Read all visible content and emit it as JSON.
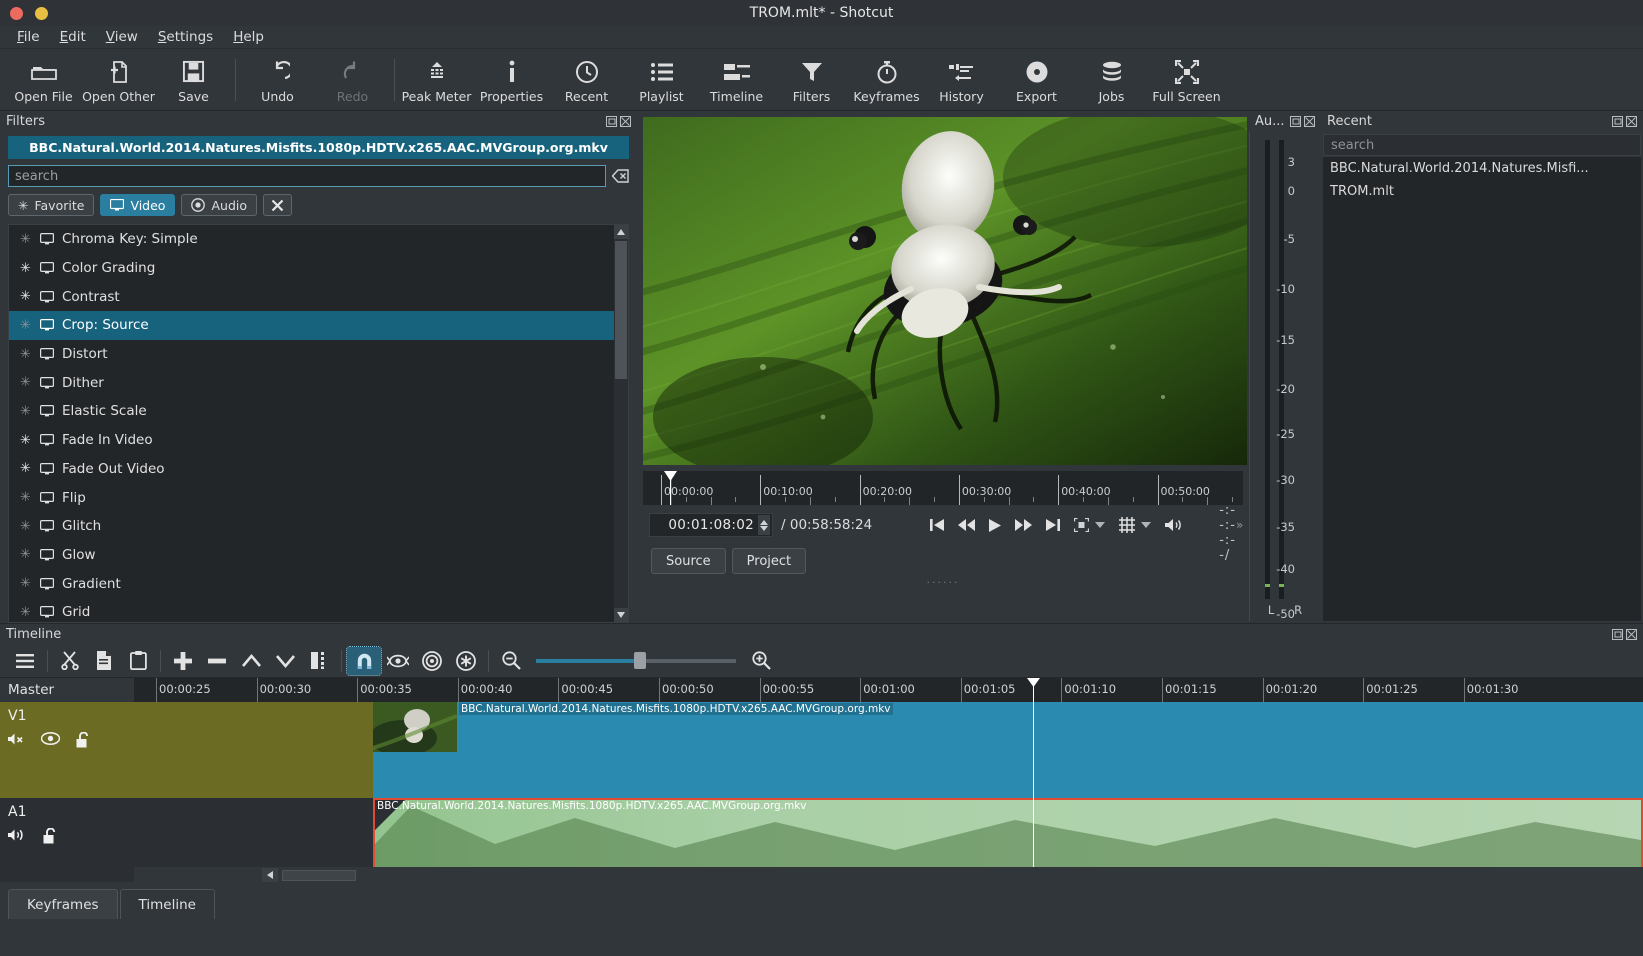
{
  "window": {
    "title": "TROM.mlt* - Shotcut"
  },
  "menubar": {
    "items": [
      "File",
      "Edit",
      "View",
      "Settings",
      "Help"
    ]
  },
  "toolbar": {
    "buttons": [
      {
        "label": "Open File",
        "icon": "folder-icon",
        "disabled": false
      },
      {
        "label": "Open Other",
        "icon": "file-add-icon",
        "disabled": false
      },
      {
        "label": "Save",
        "icon": "floppy-icon",
        "disabled": false
      },
      {
        "label": "Undo",
        "icon": "undo-icon",
        "disabled": false
      },
      {
        "label": "Redo",
        "icon": "redo-icon",
        "disabled": true
      },
      {
        "label": "Peak Meter",
        "icon": "peak-meter-icon",
        "disabled": false
      },
      {
        "label": "Properties",
        "icon": "info-icon",
        "disabled": false
      },
      {
        "label": "Recent",
        "icon": "clock-icon",
        "disabled": false
      },
      {
        "label": "Playlist",
        "icon": "list-icon",
        "disabled": false
      },
      {
        "label": "Timeline",
        "icon": "timeline-icon",
        "disabled": false
      },
      {
        "label": "Filters",
        "icon": "funnel-icon",
        "disabled": false
      },
      {
        "label": "Keyframes",
        "icon": "stopwatch-icon",
        "disabled": false
      },
      {
        "label": "History",
        "icon": "history-icon",
        "disabled": false
      },
      {
        "label": "Export",
        "icon": "disc-icon",
        "disabled": false
      },
      {
        "label": "Jobs",
        "icon": "stack-icon",
        "disabled": false
      },
      {
        "label": "Full Screen",
        "icon": "fullscreen-icon",
        "disabled": false
      }
    ]
  },
  "filters_panel": {
    "title": "Filters",
    "clip_name": "BBC.Natural.World.2014.Natures.Misfits.1080p.HDTV.x265.AAC.MVGroup.org.mkv",
    "search_placeholder": "search",
    "clear_search_icon": "clear-search-icon",
    "chips": [
      {
        "label": "Favorite",
        "icon": "asterisk-icon",
        "active": false
      },
      {
        "label": "Video",
        "icon": "monitor-icon",
        "active": true
      },
      {
        "label": "Audio",
        "icon": "speaker-round-icon",
        "active": false
      },
      {
        "label": "",
        "icon": "close-x-icon",
        "active": false
      }
    ],
    "items": [
      {
        "name": "Chroma Key: Simple",
        "favorite": false,
        "selected": false
      },
      {
        "name": "Color Grading",
        "favorite": true,
        "selected": false
      },
      {
        "name": "Contrast",
        "favorite": true,
        "selected": false
      },
      {
        "name": "Crop: Source",
        "favorite": false,
        "selected": true
      },
      {
        "name": "Distort",
        "favorite": false,
        "selected": false
      },
      {
        "name": "Dither",
        "favorite": false,
        "selected": false
      },
      {
        "name": "Elastic Scale",
        "favorite": false,
        "selected": false
      },
      {
        "name": "Fade In Video",
        "favorite": true,
        "selected": false
      },
      {
        "name": "Fade Out Video",
        "favorite": true,
        "selected": false
      },
      {
        "name": "Flip",
        "favorite": false,
        "selected": false
      },
      {
        "name": "Glitch",
        "favorite": false,
        "selected": false
      },
      {
        "name": "Glow",
        "favorite": false,
        "selected": false
      },
      {
        "name": "Gradient",
        "favorite": false,
        "selected": false
      },
      {
        "name": "Grid",
        "favorite": false,
        "selected": false
      }
    ]
  },
  "player": {
    "ruler_labels": [
      "00:00:00",
      "00:10:00",
      "00:20:00",
      "00:30:00",
      "00:40:00",
      "00:50:00"
    ],
    "position": "00:01:08:02",
    "duration": "00:58:58:24",
    "duration_separator": "/",
    "selected_duration": "--:--:--:--/",
    "transport_icons": [
      "skip-start-icon",
      "rewind-icon",
      "play-icon",
      "fast-forward-icon",
      "skip-end-icon",
      "zoom-fit-icon",
      "chevron-down-icon",
      "grid-overlay-icon",
      "chevron-down-icon",
      "volume-icon"
    ],
    "tabs": [
      {
        "label": "Source",
        "active": false
      },
      {
        "label": "Project",
        "active": false
      }
    ]
  },
  "meter_panel": {
    "title": "Au...",
    "scale": [
      "3",
      "0",
      "-5",
      "-10",
      "-15",
      "-20",
      "-25",
      "-30",
      "-35",
      "-40",
      "-50"
    ],
    "channels": [
      "L",
      "R"
    ]
  },
  "recent_panel": {
    "title": "Recent",
    "search_placeholder": "search",
    "items": [
      "BBC.Natural.World.2014.Natures.Misfi...",
      "TROM.mlt"
    ]
  },
  "timeline": {
    "title": "Timeline",
    "toolbar_icons": [
      "hamburger-menu-icon",
      "cut-icon",
      "copy-icon",
      "paste-icon",
      "append-plus-icon",
      "ripple-delete-minus-icon",
      "lift-up-icon",
      "overwrite-down-icon",
      "split-icon",
      "snap-magnet-icon",
      "scrub-while-dragging-icon",
      "ripple-icon",
      "ripple-all-tracks-icon",
      "zoom-out-icon",
      "zoom-in-icon"
    ],
    "snap_enabled": true,
    "master_label": "Master",
    "ruler_labels": [
      "00:00:25",
      "00:00:30",
      "00:00:35",
      "00:00:40",
      "00:00:45",
      "00:00:50",
      "00:00:55",
      "00:01:00",
      "00:01:05",
      "00:01:10",
      "00:01:15",
      "00:01:20",
      "00:01:25",
      "00:01:30"
    ],
    "tracks": [
      {
        "name": "V1",
        "type": "video",
        "icons": [
          "mute-off-icon",
          "eye-visible-icon",
          "unlock-icon"
        ],
        "clip_label": "BBC.Natural.World.2014.Natures.Misfits.1080p.HDTV.x265.AAC.MVGroup.org.mkv"
      },
      {
        "name": "A1",
        "type": "audio",
        "icons": [
          "speaker-icon",
          "unlock-icon"
        ],
        "clip_label": "BBC.Natural.World.2014.Natures.Misfits.1080p.HDTV.x265.AAC.MVGroup.org.mkv"
      }
    ]
  },
  "bottom_tabs": [
    {
      "label": "Keyframes",
      "active": false
    },
    {
      "label": "Timeline",
      "active": true
    }
  ],
  "colors": {
    "accent": "#17637e",
    "chip_active": "#2a7fa0",
    "clip_video": "#2a8ab0",
    "track_video_bg": "#6b6b23",
    "clip_audio": "#a8c9a0",
    "selection_red": "#e04b36",
    "window_bg": "#31363b"
  }
}
